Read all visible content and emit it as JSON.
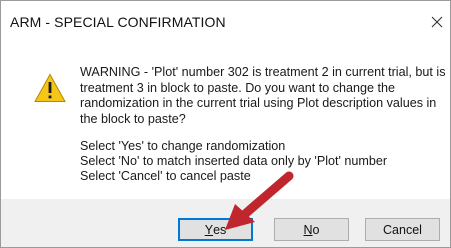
{
  "window": {
    "title": "ARM - SPECIAL CONFIRMATION",
    "close_symbol": "✕"
  },
  "message": {
    "warning_text": "WARNING - 'Plot' number 302 is treatment 2 in current trial, but is treatment 3 in block to paste. Do you want to change the randomization in the current trial using Plot description values in the block to paste?",
    "option_yes": "Select 'Yes' to change randomization",
    "option_no": "Select 'No' to match inserted data only by 'Plot' number",
    "option_cancel": "Select 'Cancel' to cancel paste"
  },
  "buttons": {
    "yes_accel": "Y",
    "yes_rest": "es",
    "no_accel": "N",
    "no_rest": "o",
    "cancel_label": "Cancel"
  },
  "icons": {
    "warning": "warning-triangle-icon",
    "annotation": "red-arrow"
  },
  "colors": {
    "warning_yellow": "#f5c518",
    "arrow_red": "#c0262d",
    "default_button_border": "#0078d7"
  }
}
